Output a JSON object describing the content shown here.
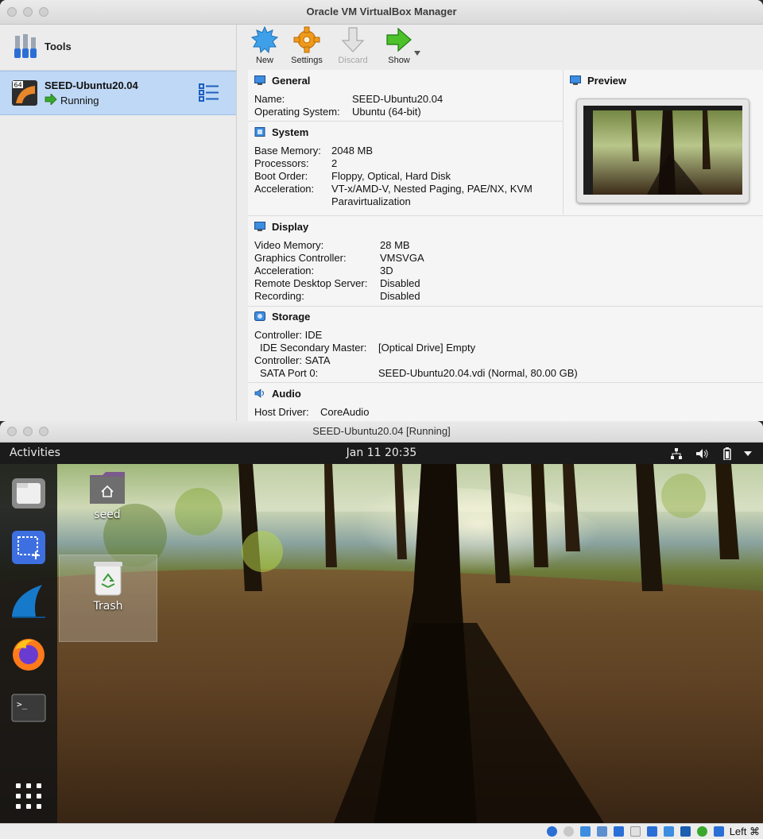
{
  "manager": {
    "title": "Oracle VM VirtualBox Manager",
    "tools_label": "Tools",
    "vm": {
      "name": "SEED-Ubuntu20.04",
      "state": "Running",
      "badge": "64"
    },
    "toolbar": {
      "new": "New",
      "settings": "Settings",
      "discard": "Discard",
      "show": "Show"
    },
    "general": {
      "title": "General",
      "rows": [
        {
          "label": "Name:",
          "value": "SEED-Ubuntu20.04"
        },
        {
          "label": "Operating System:",
          "value": "Ubuntu (64-bit)"
        }
      ]
    },
    "system": {
      "title": "System",
      "rows": [
        {
          "label": "Base Memory:",
          "value": "2048 MB"
        },
        {
          "label": "Processors:",
          "value": "2"
        },
        {
          "label": "Boot Order:",
          "value": "Floppy, Optical, Hard Disk"
        },
        {
          "label": "Acceleration:",
          "value": "VT-x/AMD-V, Nested Paging, PAE/NX, KVM"
        }
      ],
      "accel_line2": "Paravirtualization"
    },
    "preview": {
      "title": "Preview"
    },
    "display": {
      "title": "Display",
      "rows": [
        {
          "label": "Video Memory:",
          "value": "28 MB"
        },
        {
          "label": "Graphics Controller:",
          "value": "VMSVGA"
        },
        {
          "label": "Acceleration:",
          "value": "3D"
        },
        {
          "label": "Remote Desktop Server:",
          "value": "Disabled"
        },
        {
          "label": "Recording:",
          "value": "Disabled"
        }
      ]
    },
    "storage": {
      "title": "Storage",
      "controller1": "Controller: IDE",
      "port1_label": "IDE Secondary Master:",
      "port1_value": "[Optical Drive] Empty",
      "controller2": "Controller: SATA",
      "port2_label": "SATA Port 0:",
      "port2_value": "SEED-Ubuntu20.04.vdi (Normal, 80.00 GB)"
    },
    "audio": {
      "title": "Audio",
      "row": {
        "label": "Host Driver:",
        "value": "CoreAudio"
      }
    }
  },
  "guest": {
    "title": "SEED-Ubuntu20.04 [Running]",
    "activities": "Activities",
    "clock": "Jan 11  20:35",
    "desktop_items": {
      "home": "seed",
      "trash": "Trash"
    },
    "host_key": "Left ⌘"
  },
  "colors": {
    "selection": "#bfd8f5",
    "running_arrow": "#3aa82c",
    "ubuntu_bar": "#1b1b1b"
  }
}
